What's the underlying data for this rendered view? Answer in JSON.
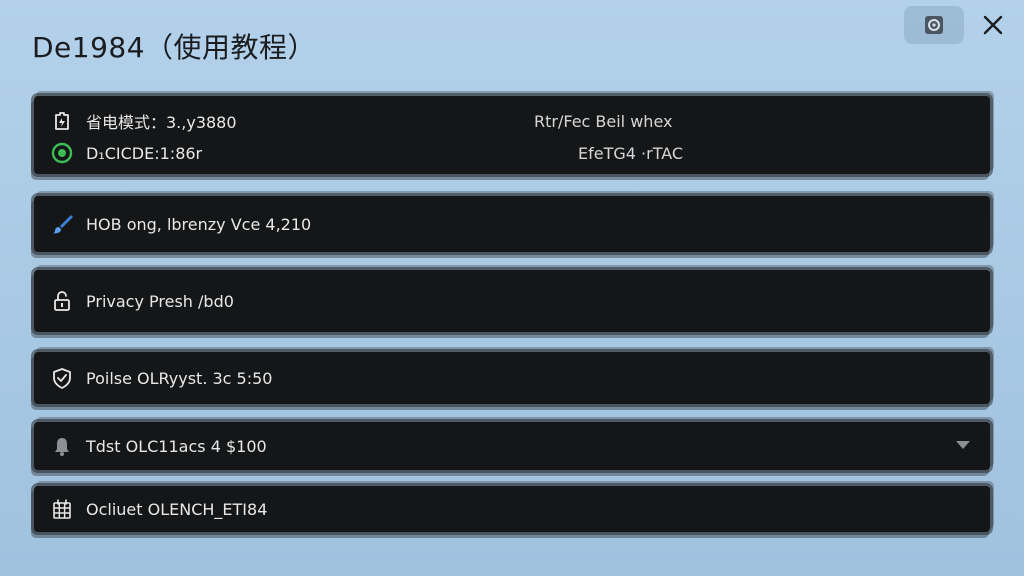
{
  "window": {
    "title": "De1984（使用教程）"
  },
  "rows": [
    {
      "label": "省电模式：3.,y3880",
      "sub_label": "D₁CICDE:1:86r",
      "right_top": "Rtr/Fec Beil whex",
      "right_bottom": "EfeTG4 ·rTAC",
      "icon": "battery-saver-icon",
      "sub_icon": "green-status-icon"
    },
    {
      "label": "HOB ong, lbrenzy Vce 4,210",
      "icon": "brush-icon"
    },
    {
      "label": "Privacy Presh /bd0",
      "icon": "unlock-icon"
    },
    {
      "label": "Poilse OLRyyst. 3c 5:50",
      "icon": "shield-check-icon"
    },
    {
      "label": "Tdst OLC11acs 4 $100",
      "icon": "bell-icon"
    },
    {
      "label": "Ocliuet OLENCH_ETI84",
      "icon": "grid-box-icon"
    }
  ],
  "colors": {
    "background": "#aecde8",
    "row": "#151617",
    "accent_green": "#3dbb54",
    "accent_blue": "#3b82d6"
  }
}
